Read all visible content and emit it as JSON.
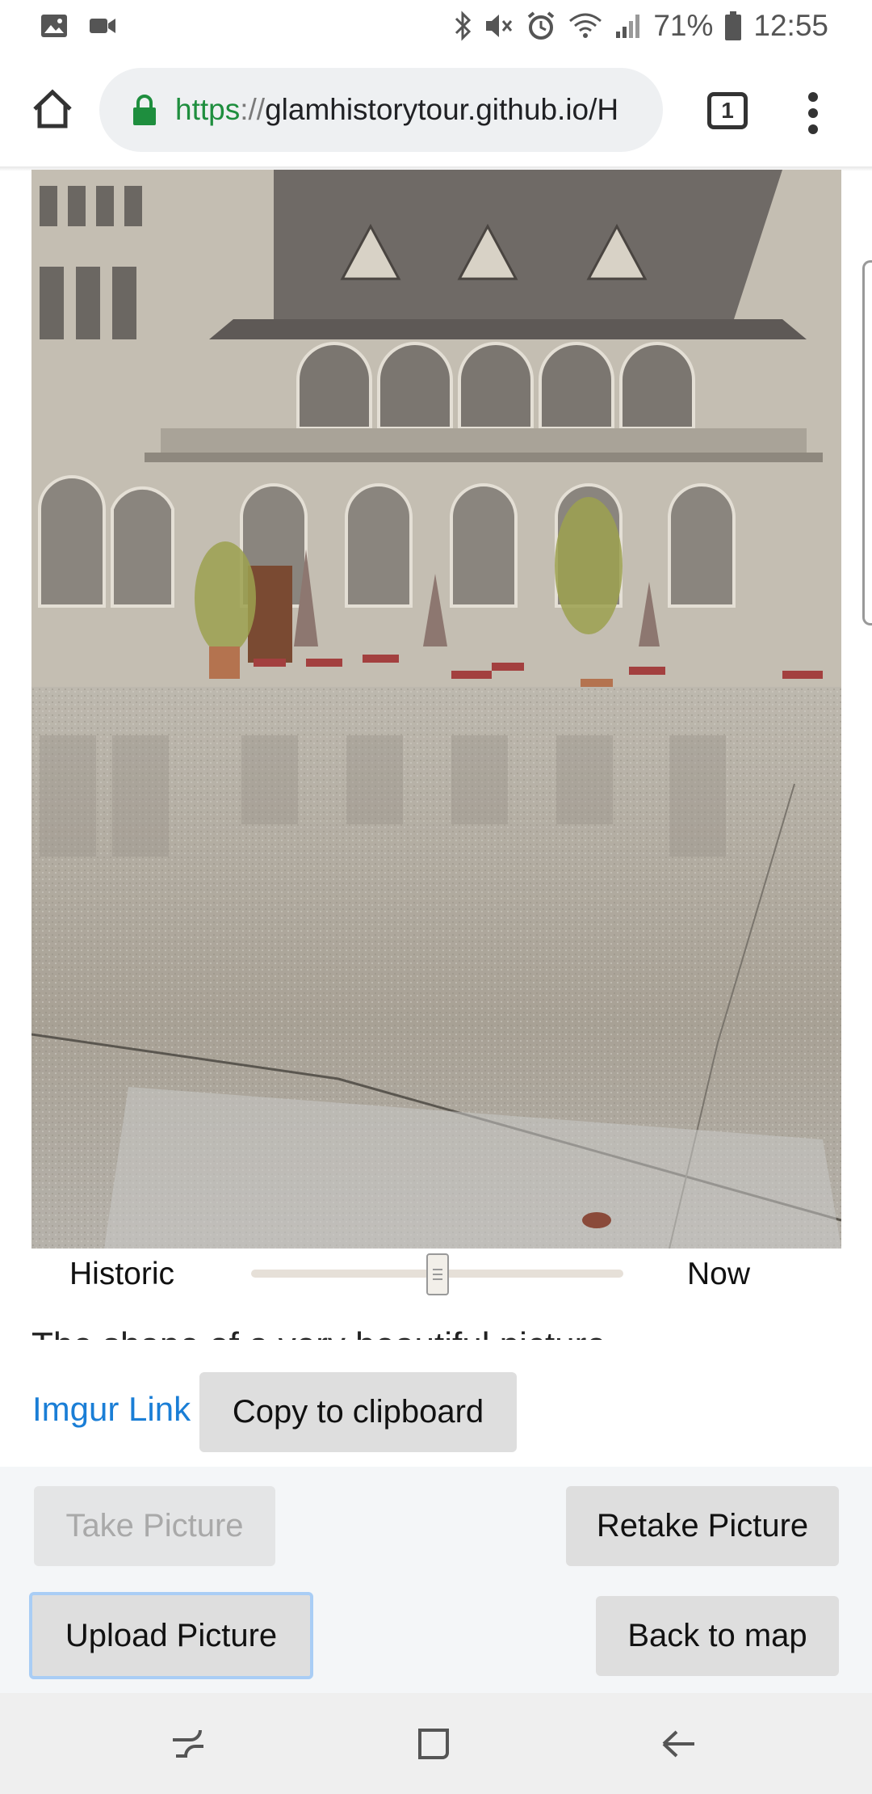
{
  "status_bar": {
    "battery_percent": "71%",
    "time": "12:55",
    "icons": [
      "image-icon",
      "video-icon",
      "bluetooth-icon",
      "mute-icon",
      "alarm-icon",
      "wifi-icon",
      "signal-icon",
      "battery-icon"
    ]
  },
  "browser": {
    "url_scheme": "https",
    "url_separator": "://",
    "url_rest": "glamhistorytour.github.io/H",
    "tab_count": "1",
    "secure_color": "#1e8e3e"
  },
  "compare": {
    "historic_label": "Historic",
    "now_label": "Now",
    "slider_value": 0.5
  },
  "description_clipped": "The shape of a very beautiful picture",
  "link_row": {
    "imgur_link": "Imgur Link",
    "copy_button": "Copy to clipboard"
  },
  "actions": {
    "take_picture": "Take Picture",
    "retake_picture": "Retake Picture",
    "upload_picture": "Upload Picture",
    "back_to_map": "Back to map"
  },
  "colors": {
    "link": "#1a7ed6",
    "button_bg": "#dedede",
    "focus_ring": "#a9cdf5"
  }
}
